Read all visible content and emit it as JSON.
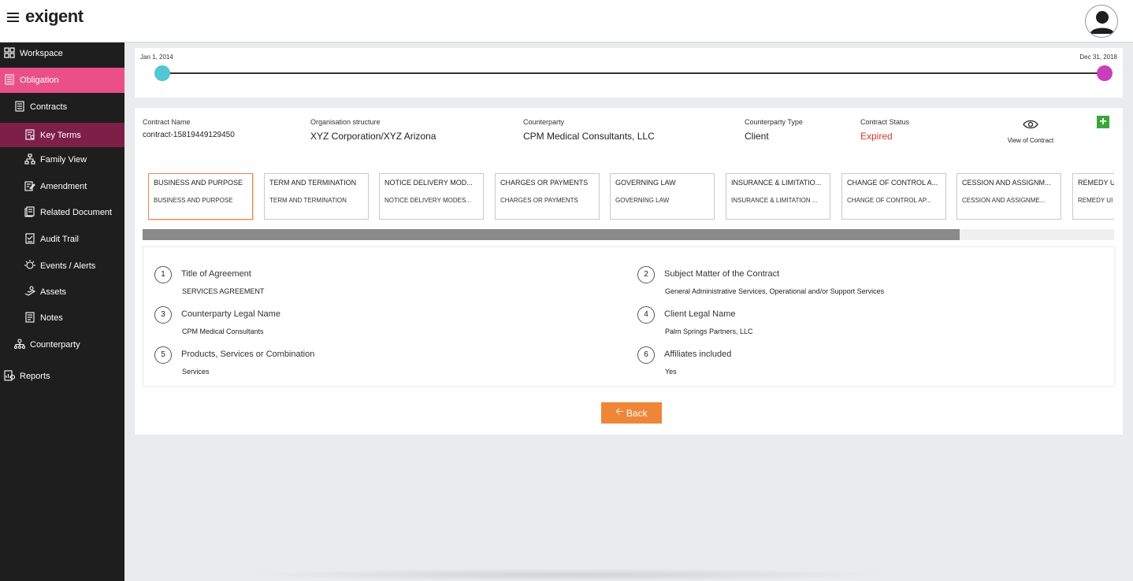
{
  "app": {
    "logo": "exigent"
  },
  "sidebar": {
    "items": [
      {
        "label": "Workspace",
        "icon": "grid-icon"
      },
      {
        "label": "Obligation",
        "icon": "document-icon"
      },
      {
        "label": "Contracts",
        "icon": "contract-icon"
      },
      {
        "label": "Key Terms",
        "icon": "key-terms-icon"
      },
      {
        "label": "Family View",
        "icon": "hierarchy-icon"
      },
      {
        "label": "Amendment",
        "icon": "edit-document-icon"
      },
      {
        "label": "Related Document",
        "icon": "documents-icon"
      },
      {
        "label": "Audit Trail",
        "icon": "audit-icon"
      },
      {
        "label": "Events / Alerts",
        "icon": "alert-icon"
      },
      {
        "label": "Assets",
        "icon": "assets-icon"
      },
      {
        "label": "Notes",
        "icon": "notes-icon"
      },
      {
        "label": "Counterparty",
        "icon": "org-chart-icon"
      },
      {
        "label": "Reports",
        "icon": "reports-icon"
      }
    ]
  },
  "timeline": {
    "start": "Jan 1, 2014",
    "end": "Dec 31, 2018",
    "start_color": "#54c6d4",
    "end_color": "#c93fba"
  },
  "contract": {
    "name_label": "Contract Name",
    "name": "contract-15819449129450",
    "org_label": "Organisation structure",
    "org": "XYZ Corporation/XYZ Arizona",
    "counterparty_label": "Counterparty",
    "counterparty": "CPM Medical Consultants, LLC",
    "type_label": "Counterparty Type",
    "type": "Client",
    "status_label": "Contract Status",
    "status": "Expired",
    "view_label": "View of Contract",
    "add_label": "+"
  },
  "tabs": [
    {
      "title": "BUSINESS AND PURPOSE",
      "sub": "BUSINESS AND PURPOSE"
    },
    {
      "title": "TERM AND TERMINATION",
      "sub": "TERM AND TERMINATION"
    },
    {
      "title": "NOTICE DELIVERY MOD...",
      "sub": "NOTICE DELIVERY MODES..."
    },
    {
      "title": "CHARGES OR PAYMENTS",
      "sub": "CHARGES OR PAYMENTS"
    },
    {
      "title": "GOVERNING LAW",
      "sub": "GOVERNING LAW"
    },
    {
      "title": "INSURANCE & LIMITATIO...",
      "sub": "INSURANCE & LIMITATION ..."
    },
    {
      "title": "CHANGE OF CONTROL A...",
      "sub": "CHANGE OF CONTROL AP..."
    },
    {
      "title": "CESSION AND ASSIGNM...",
      "sub": "CESSION AND ASSIGNME..."
    },
    {
      "title": "REMEDY U",
      "sub": "REMEDY UI"
    }
  ],
  "terms": [
    {
      "num": "1",
      "label": "Title of Agreement",
      "value": "SERVICES AGREEMENT"
    },
    {
      "num": "2",
      "label": "Subject Matter of the Contract",
      "value": "General Administrative Services, Operational and/or Support Services"
    },
    {
      "num": "3",
      "label": "Counterparty Legal Name",
      "value": "CPM Medical Consultants"
    },
    {
      "num": "4",
      "label": "Client Legal Name",
      "value": "Palm Springs Partners, LLC"
    },
    {
      "num": "5",
      "label": "Products, Services or Combination",
      "value": "Services"
    },
    {
      "num": "6",
      "label": "Affiliates included",
      "value": "Yes"
    }
  ],
  "back_button": {
    "label": "Back"
  },
  "colors": {
    "accent_pink": "#ea4f86",
    "sub_active": "#7d2048",
    "back_orange": "#ee8639",
    "expired_red": "#d9362b"
  }
}
